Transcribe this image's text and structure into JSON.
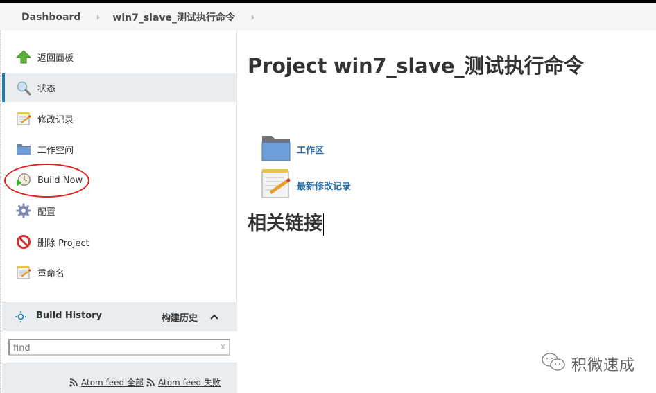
{
  "breadcrumb": {
    "items": [
      "Dashboard",
      "win7_slave_测试执行命令"
    ]
  },
  "sidebar": {
    "tasks": [
      {
        "label": "返回面板",
        "icon": "up-arrow-icon"
      },
      {
        "label": "状态",
        "icon": "magnifier-icon",
        "active": true
      },
      {
        "label": "修改记录",
        "icon": "notepad-icon"
      },
      {
        "label": "工作空间",
        "icon": "folder-icon"
      },
      {
        "label": "Build Now",
        "icon": "clock-play-icon",
        "highlighted": true
      },
      {
        "label": "配置",
        "icon": "gear-icon"
      },
      {
        "label": "删除 Project",
        "icon": "no-entry-icon"
      },
      {
        "label": "重命名",
        "icon": "notepad-icon"
      }
    ]
  },
  "build_history": {
    "title": "Build History",
    "trend_link": "构建历史",
    "search": {
      "placeholder": "find",
      "value": "",
      "clear_label": "x"
    },
    "feeds": [
      {
        "label": "Atom feed 全部"
      },
      {
        "label": "Atom feed 失败"
      }
    ]
  },
  "main": {
    "title": "Project win7_slave_测试执行命令",
    "links": [
      {
        "label": "工作区",
        "icon": "folder-icon"
      },
      {
        "label": "最新修改记录",
        "icon": "notepad-icon"
      }
    ],
    "section_heading": "相关链接"
  },
  "watermark": {
    "text": "积微速成",
    "icon": "wechat-icon"
  },
  "colors": {
    "accent": "#1f7ab8",
    "link": "#2a6ea6",
    "highlight_ellipse": "#e02020",
    "panel_bg": "#e9edf0"
  }
}
